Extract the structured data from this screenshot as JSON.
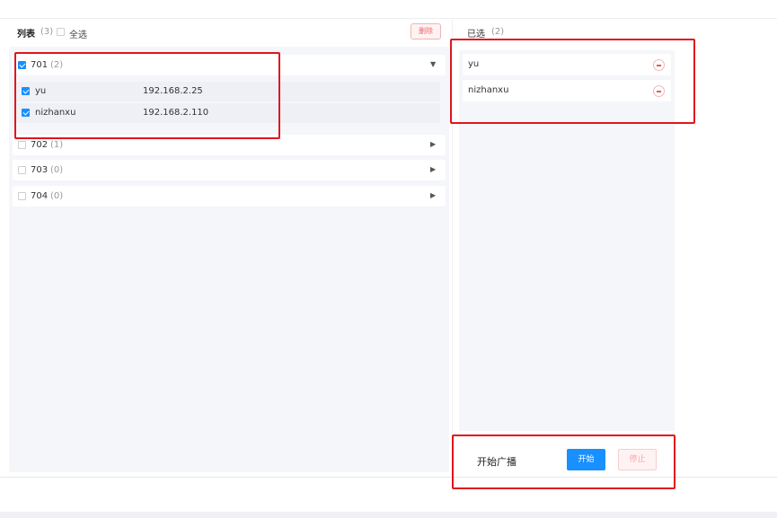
{
  "list_panel": {
    "title": "列表",
    "count": "(3)",
    "select_all_label": "全选",
    "delete_label": "删除",
    "groups": [
      {
        "name": "701",
        "count": "(2)",
        "checked": true,
        "expanded": true,
        "arrow": "▼",
        "members": [
          {
            "name": "yu",
            "ip": "192.168.2.25",
            "checked": true
          },
          {
            "name": "nizhanxu",
            "ip": "192.168.2.110",
            "checked": true
          }
        ]
      },
      {
        "name": "702",
        "count": "(1)",
        "checked": false,
        "expanded": false,
        "arrow": "▶"
      },
      {
        "name": "703",
        "count": "(0)",
        "checked": false,
        "expanded": false,
        "arrow": "▶"
      },
      {
        "name": "704",
        "count": "(0)",
        "checked": false,
        "expanded": false,
        "arrow": "▶"
      }
    ]
  },
  "selected_panel": {
    "title": "已选",
    "count": "(2)",
    "items": [
      {
        "name": "yu"
      },
      {
        "name": "nizhanxu"
      }
    ]
  },
  "broadcast": {
    "label": "开始广播",
    "start_label": "开始",
    "stop_label": "停止"
  },
  "colors": {
    "primary": "#1890ff",
    "danger": "#e35b5b",
    "annotation": "#e0161b"
  }
}
